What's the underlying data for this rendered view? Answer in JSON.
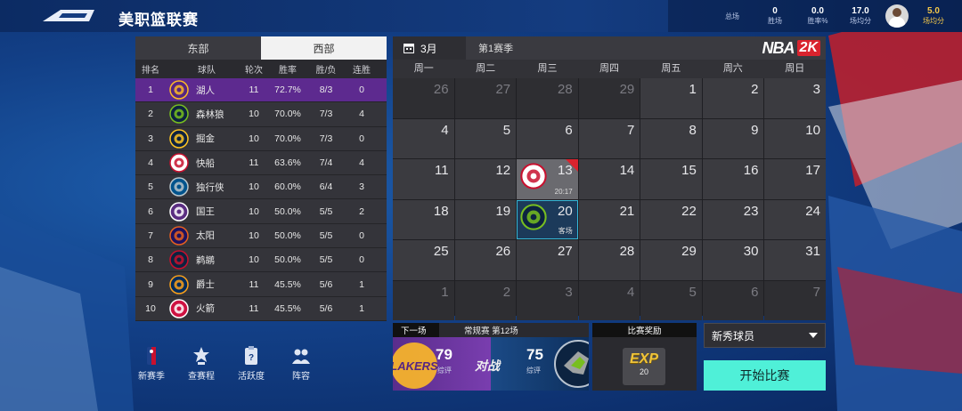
{
  "header": {
    "title": "美职篮联赛"
  },
  "stats": [
    {
      "value": "",
      "label": "总场"
    },
    {
      "value": "0",
      "label": "胜场"
    },
    {
      "value": "0.0",
      "label": "胜率%"
    },
    {
      "value": "17.0",
      "label": "场均分"
    },
    {
      "value": "5.0",
      "label": "场均分"
    }
  ],
  "standings": {
    "tabs": [
      "东部",
      "西部"
    ],
    "columns": [
      "排名",
      "球队",
      "轮次",
      "胜率",
      "胜/负",
      "连胜"
    ],
    "rows": [
      {
        "rank": "1",
        "team": "湖人",
        "round": "11",
        "pct": "72.7%",
        "wl": "8/3",
        "streak": "0",
        "abbr": "LAL",
        "color": "#552583",
        "accent": "#fdb927"
      },
      {
        "rank": "2",
        "team": "森林狼",
        "round": "10",
        "pct": "70.0%",
        "wl": "7/3",
        "streak": "4",
        "abbr": "MIN",
        "color": "#0c2340",
        "accent": "#78be20"
      },
      {
        "rank": "3",
        "team": "掘金",
        "round": "10",
        "pct": "70.0%",
        "wl": "7/3",
        "streak": "0",
        "abbr": "DEN",
        "color": "#0e2240",
        "accent": "#fec524"
      },
      {
        "rank": "4",
        "team": "快船",
        "round": "11",
        "pct": "63.6%",
        "wl": "7/4",
        "streak": "4",
        "abbr": "LAC",
        "color": "#ffffff",
        "accent": "#c8102e"
      },
      {
        "rank": "5",
        "team": "独行侠",
        "round": "10",
        "pct": "60.0%",
        "wl": "6/4",
        "streak": "3",
        "abbr": "DAL",
        "color": "#00538c",
        "accent": "#b8c4ca"
      },
      {
        "rank": "6",
        "team": "国王",
        "round": "10",
        "pct": "50.0%",
        "wl": "5/5",
        "streak": "2",
        "abbr": "SAC",
        "color": "#5a2d81",
        "accent": "#ffffff"
      },
      {
        "rank": "7",
        "team": "太阳",
        "round": "10",
        "pct": "50.0%",
        "wl": "5/5",
        "streak": "0",
        "abbr": "PHX",
        "color": "#1d1160",
        "accent": "#e56020"
      },
      {
        "rank": "8",
        "team": "鹈鹕",
        "round": "10",
        "pct": "50.0%",
        "wl": "5/5",
        "streak": "0",
        "abbr": "NOP",
        "color": "#0c2340",
        "accent": "#c8102e"
      },
      {
        "rank": "9",
        "team": "爵士",
        "round": "11",
        "pct": "45.5%",
        "wl": "5/6",
        "streak": "1",
        "abbr": "UTA",
        "color": "#002b5c",
        "accent": "#f9a01b"
      },
      {
        "rank": "10",
        "team": "火箭",
        "round": "11",
        "pct": "45.5%",
        "wl": "5/6",
        "streak": "1",
        "abbr": "HOU",
        "color": "#ce1141",
        "accent": "#ffffff"
      }
    ]
  },
  "calendar": {
    "month": "3月",
    "season": "第1赛季",
    "brand": "NBA",
    "brand_k": "2K",
    "weekdays": [
      "周一",
      "周二",
      "周三",
      "周四",
      "周五",
      "周六",
      "周日"
    ],
    "days": [
      {
        "d": "26",
        "dim": true
      },
      {
        "d": "27",
        "dim": true
      },
      {
        "d": "28",
        "dim": true
      },
      {
        "d": "29",
        "dim": true
      },
      {
        "d": "1"
      },
      {
        "d": "2"
      },
      {
        "d": "3"
      },
      {
        "d": "4"
      },
      {
        "d": "5"
      },
      {
        "d": "6"
      },
      {
        "d": "7"
      },
      {
        "d": "8"
      },
      {
        "d": "9"
      },
      {
        "d": "10"
      },
      {
        "d": "11"
      },
      {
        "d": "12"
      },
      {
        "d": "13",
        "game": "LAC",
        "sub": "20:17",
        "played": true
      },
      {
        "d": "14"
      },
      {
        "d": "15"
      },
      {
        "d": "16"
      },
      {
        "d": "17"
      },
      {
        "d": "18"
      },
      {
        "d": "19"
      },
      {
        "d": "20",
        "game": "MIN",
        "sub": "客场",
        "today": true
      },
      {
        "d": "21"
      },
      {
        "d": "22"
      },
      {
        "d": "23"
      },
      {
        "d": "24"
      },
      {
        "d": "25"
      },
      {
        "d": "26"
      },
      {
        "d": "27"
      },
      {
        "d": "28"
      },
      {
        "d": "29"
      },
      {
        "d": "30"
      },
      {
        "d": "31"
      },
      {
        "d": "1",
        "dim": true
      },
      {
        "d": "2",
        "dim": true
      },
      {
        "d": "3",
        "dim": true
      },
      {
        "d": "4",
        "dim": true
      },
      {
        "d": "5",
        "dim": true
      },
      {
        "d": "6",
        "dim": true
      },
      {
        "d": "7",
        "dim": true
      }
    ]
  },
  "menu": [
    {
      "label": "新赛季",
      "icon": "nba-logo-icon"
    },
    {
      "label": "查赛程",
      "icon": "star-trophy-icon"
    },
    {
      "label": "活跃度",
      "icon": "clipboard-icon"
    },
    {
      "label": "阵容",
      "icon": "players-icon"
    }
  ],
  "next_game": {
    "tag": "下一场",
    "title": "常规赛 第12场",
    "home_wordmark": "LAKERS",
    "home_rating": "79",
    "home_rating_label": "综评",
    "vs": "对战",
    "away_rating": "75",
    "away_rating_label": "综评"
  },
  "reward": {
    "title": "比赛奖励",
    "type": "EXP",
    "value": "20"
  },
  "mode_select": {
    "value": "新秀球员"
  },
  "start_button": {
    "label": "开始比赛"
  },
  "colors": {
    "accent_cyan": "#4ff0d8",
    "highlight_purple": "#5d2a8f",
    "nba2k_red": "#d9232e"
  }
}
